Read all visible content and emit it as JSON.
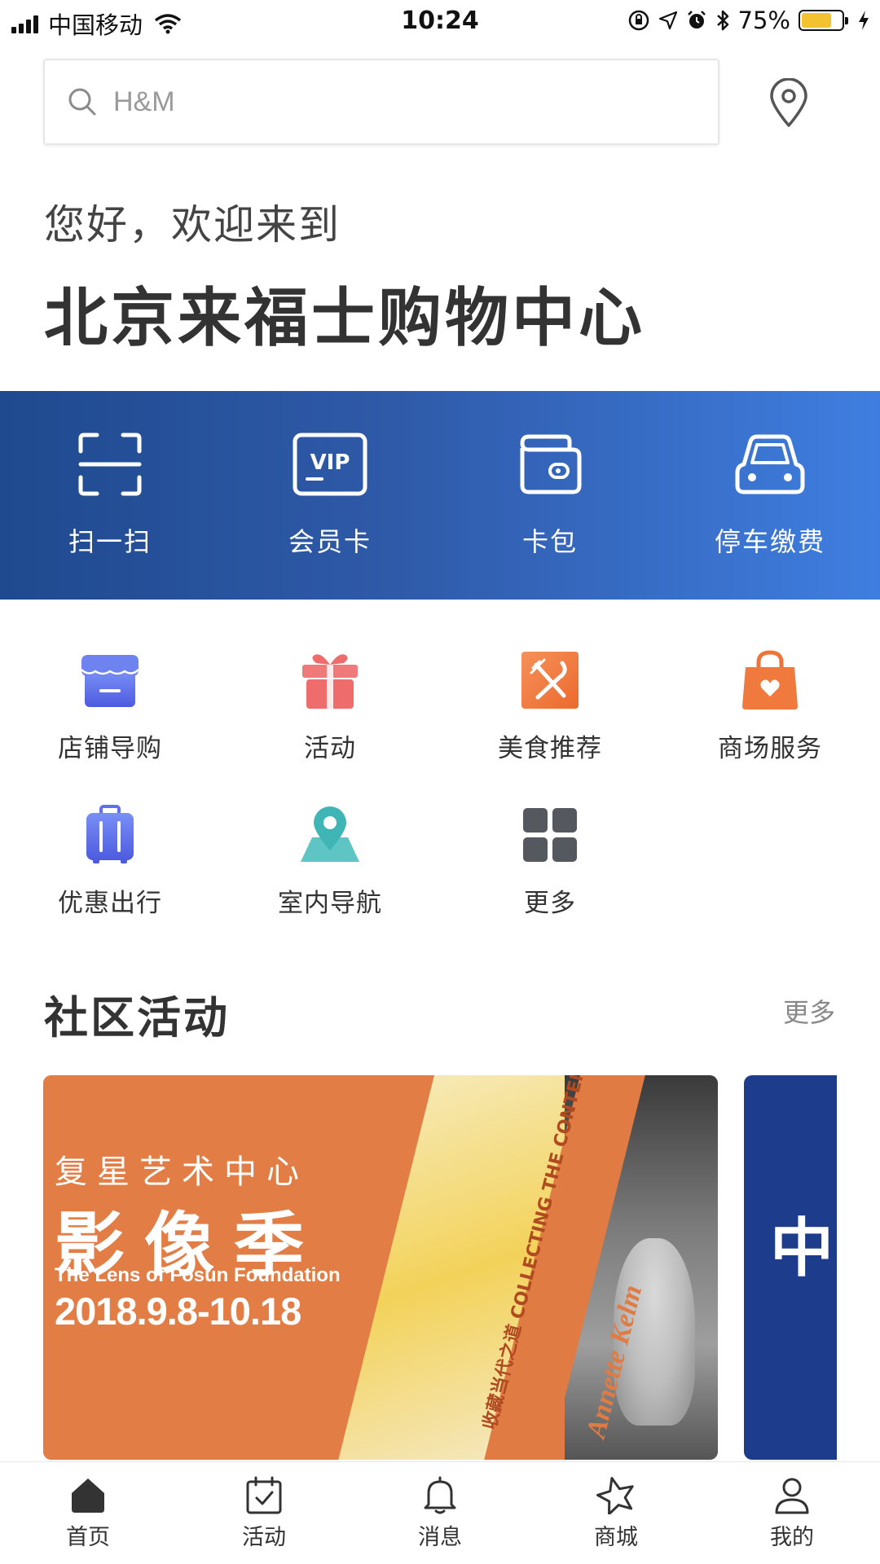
{
  "status_bar": {
    "carrier": "中国移动",
    "time": "10:24",
    "battery_percent": "75%",
    "battery_level": 0.75
  },
  "search": {
    "placeholder": "H&M"
  },
  "header": {
    "greeting": "您好，欢迎来到",
    "mall_name": "北京来福士购物中心"
  },
  "banner": {
    "items": [
      {
        "label": "扫一扫",
        "icon": "scan-icon"
      },
      {
        "label": "会员卡",
        "icon": "vip-card-icon",
        "badge": "VIP"
      },
      {
        "label": "卡包",
        "icon": "wallet-icon"
      },
      {
        "label": "停车缴费",
        "icon": "car-icon"
      }
    ]
  },
  "services": {
    "items": [
      {
        "label": "店铺导购",
        "icon": "store-icon",
        "color": "#5b6be8"
      },
      {
        "label": "活动",
        "icon": "gift-icon",
        "color": "#ee6c6c"
      },
      {
        "label": "美食推荐",
        "icon": "dining-icon",
        "color": "#f07a3e"
      },
      {
        "label": "商场服务",
        "icon": "shopping-bag-icon",
        "color": "#f07a3e"
      },
      {
        "label": "优惠出行",
        "icon": "luggage-icon",
        "color": "#5b6be8"
      },
      {
        "label": "室内导航",
        "icon": "map-pin-icon",
        "color": "#3fb5b5"
      },
      {
        "label": "更多",
        "icon": "grid-icon",
        "color": "#55585e"
      }
    ]
  },
  "community": {
    "title": "社区活动",
    "more": "更多",
    "cards": [
      {
        "line1": "复星艺术中心",
        "line2": "影像季",
        "subtitle": "The Lens of Fosun Foundation",
        "date": "2018.9.8-10.18",
        "side_text": "收藏当代之道 COLLECTING THE CONTEMPORARY",
        "artist": "Annette Kelm"
      },
      {
        "char": "中",
        "color": "#1d3d8c"
      }
    ]
  },
  "tabbar": {
    "items": [
      {
        "label": "首页",
        "icon": "home-icon",
        "active": true
      },
      {
        "label": "活动",
        "icon": "calendar-check-icon"
      },
      {
        "label": "消息",
        "icon": "bell-icon"
      },
      {
        "label": "商城",
        "icon": "star-icon"
      },
      {
        "label": "我的",
        "icon": "user-icon"
      }
    ]
  },
  "colors": {
    "banner_start": "#1f4a8f",
    "banner_end": "#3f7ee0",
    "battery": "#f2c230"
  }
}
